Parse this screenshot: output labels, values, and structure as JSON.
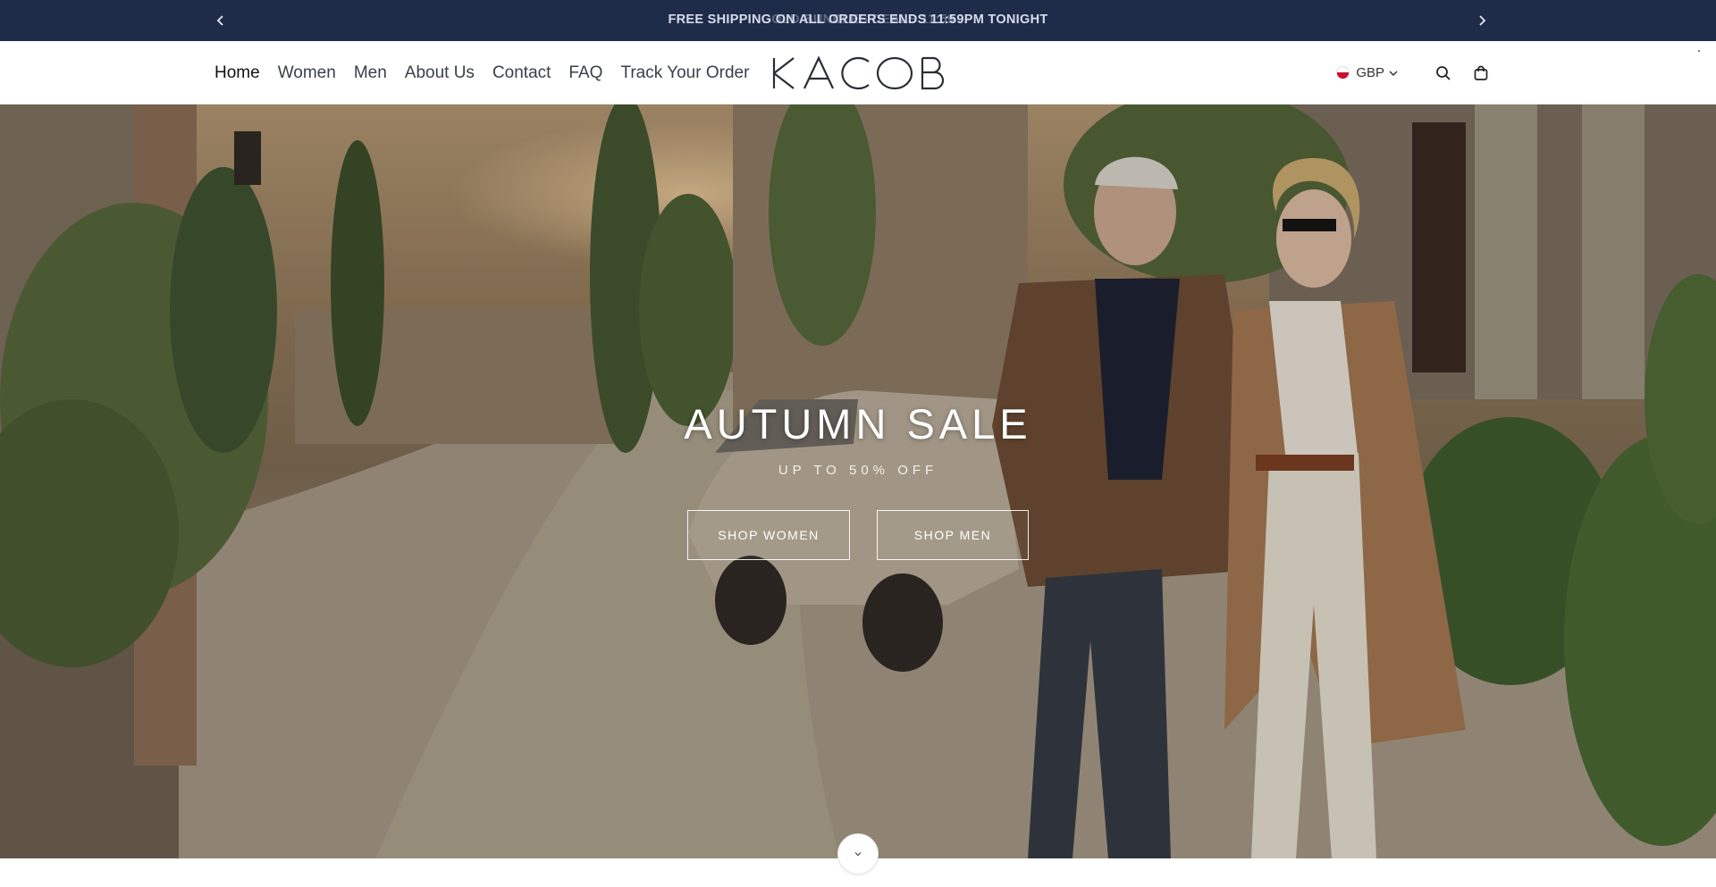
{
  "announcement": {
    "message": "FREE SHIPPING ON ALL ORDERS ENDS 11:59PM TONIGHT",
    "ghost_message": "GOLD BUNDLES DEALS 11:59",
    "prev_icon": "chevron-left-icon",
    "next_icon": "chevron-right-icon",
    "background_color": "#1e2c49"
  },
  "header": {
    "nav": [
      {
        "label": "Home",
        "active": true
      },
      {
        "label": "Women"
      },
      {
        "label": "Men"
      },
      {
        "label": "About Us"
      },
      {
        "label": "Contact"
      },
      {
        "label": "FAQ"
      },
      {
        "label": "Track Your Order"
      }
    ],
    "logo_text": "KACOB",
    "currency": {
      "code": "GBP",
      "flag_icon": "uk-flag-icon"
    },
    "icons": [
      "search-icon",
      "shopping-bag-icon"
    ]
  },
  "hero": {
    "title": "AUTUMN SALE",
    "subtitle": "UP TO 50% OFF",
    "buttons": [
      {
        "label": "SHOP WOMEN"
      },
      {
        "label": "SHOP MEN"
      }
    ],
    "scroll_icon": "chevron-down-icon"
  }
}
